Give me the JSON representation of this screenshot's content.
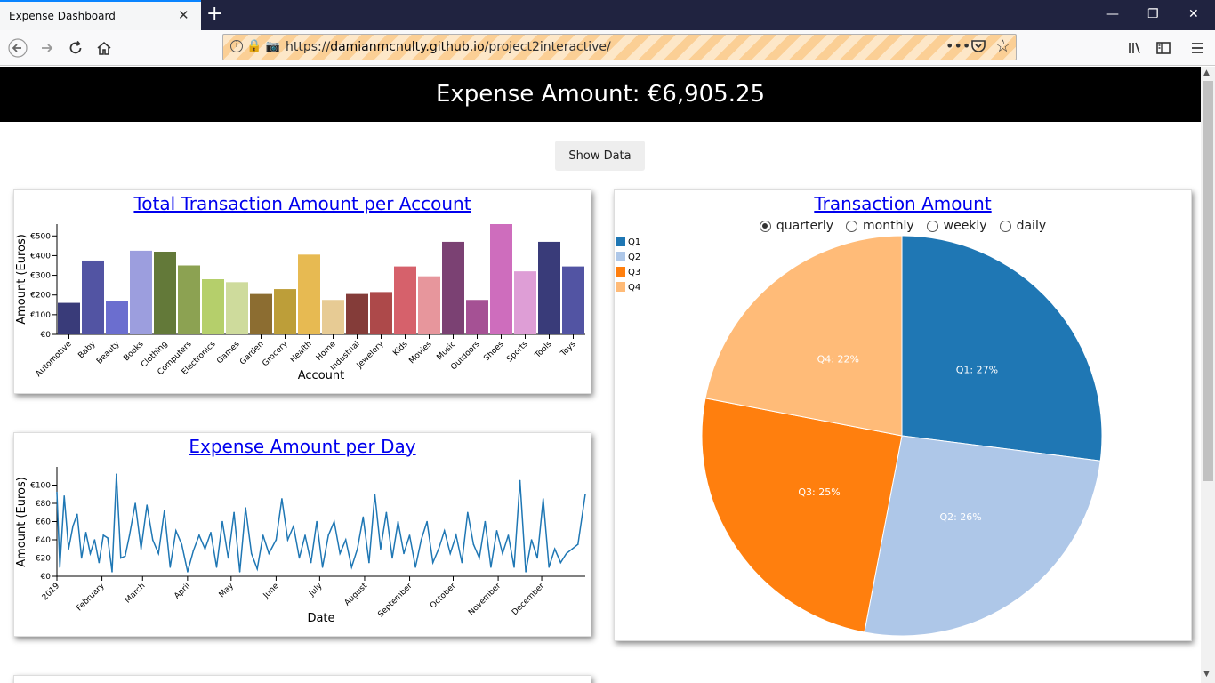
{
  "browser": {
    "tab_title": "Expense Dashboard",
    "url_prefix": "https://",
    "url_host": "damianmcnulty.github.io",
    "url_path": "/project2interactive/"
  },
  "header": {
    "title": "Expense Amount: €6,905.25"
  },
  "show_data_label": "Show Data",
  "colors": {
    "header_bg": "#000000",
    "link": "#0000ee",
    "line": "#1f77b4",
    "q1": "#1f77b4",
    "q2": "#aec7e8",
    "q3": "#ff7f0e",
    "q4": "#ffbb78"
  },
  "bar_card": {
    "title": "Total Transaction Amount per Account"
  },
  "line_card": {
    "title": "Expense Amount per Day"
  },
  "pie_card": {
    "title": "Transaction Amount",
    "radio_options": [
      {
        "label": "quarterly",
        "selected": true
      },
      {
        "label": "monthly",
        "selected": false
      },
      {
        "label": "weekly",
        "selected": false
      },
      {
        "label": "daily",
        "selected": false
      }
    ]
  },
  "chart_data": [
    {
      "type": "bar",
      "title": "Total Transaction Amount per Account",
      "xlabel": "Account",
      "ylabel": "Amount (Euros)",
      "ylim": [
        0,
        560
      ],
      "yticks": [
        "€0",
        "€100",
        "€200",
        "€300",
        "€400",
        "€500"
      ],
      "categories": [
        "Automotive",
        "Baby",
        "Beauty",
        "Books",
        "Clothing",
        "Computers",
        "Electronics",
        "Games",
        "Garden",
        "Grocery",
        "Health",
        "Home",
        "Industrial",
        "Jewelery",
        "Kids",
        "Movies",
        "Music",
        "Outdoors",
        "Shoes",
        "Sports",
        "Tools",
        "Toys"
      ],
      "values": [
        160,
        375,
        170,
        425,
        420,
        350,
        280,
        265,
        205,
        230,
        405,
        175,
        205,
        215,
        345,
        295,
        470,
        175,
        560,
        320,
        470,
        345
      ],
      "bar_colors": [
        "#393b79",
        "#5254a3",
        "#6b6ecf",
        "#9c9ede",
        "#637939",
        "#8ca252",
        "#b5cf6b",
        "#cedb9c",
        "#8c6d31",
        "#bd9e39",
        "#e7ba52",
        "#e7cb94",
        "#843c39",
        "#ad494a",
        "#d6616b",
        "#e7969c",
        "#7b4173",
        "#a55194",
        "#ce6dbd",
        "#de9ed6",
        "#393b79",
        "#5254a3"
      ]
    },
    {
      "type": "line",
      "title": "Expense Amount per Day",
      "xlabel": "Date",
      "ylabel": "Amount (Euros)",
      "ylim": [
        0,
        120
      ],
      "yticks": [
        "€0",
        "€20",
        "€40",
        "€60",
        "€80",
        "€100"
      ],
      "xticks": [
        "2019",
        "February",
        "March",
        "April",
        "May",
        "June",
        "July",
        "August",
        "September",
        "October",
        "November",
        "December"
      ],
      "x": [
        "2019-01-01",
        "2019-01-03",
        "2019-01-06",
        "2019-01-09",
        "2019-01-12",
        "2019-01-15",
        "2019-01-18",
        "2019-01-21",
        "2019-01-24",
        "2019-01-27",
        "2019-01-30",
        "2019-02-02",
        "2019-02-05",
        "2019-02-08",
        "2019-02-11",
        "2019-02-14",
        "2019-02-17",
        "2019-02-20",
        "2019-02-24",
        "2019-02-28",
        "2019-03-04",
        "2019-03-08",
        "2019-03-12",
        "2019-03-16",
        "2019-03-20",
        "2019-03-24",
        "2019-03-28",
        "2019-04-01",
        "2019-04-05",
        "2019-04-09",
        "2019-04-13",
        "2019-04-17",
        "2019-04-21",
        "2019-04-25",
        "2019-04-29",
        "2019-05-03",
        "2019-05-07",
        "2019-05-11",
        "2019-05-15",
        "2019-05-19",
        "2019-05-23",
        "2019-05-27",
        "2019-06-01",
        "2019-06-05",
        "2019-06-09",
        "2019-06-13",
        "2019-06-17",
        "2019-06-21",
        "2019-06-25",
        "2019-06-29",
        "2019-07-03",
        "2019-07-07",
        "2019-07-11",
        "2019-07-15",
        "2019-07-19",
        "2019-07-23",
        "2019-07-27",
        "2019-07-31",
        "2019-08-04",
        "2019-08-08",
        "2019-08-12",
        "2019-08-16",
        "2019-08-20",
        "2019-08-24",
        "2019-08-28",
        "2019-09-01",
        "2019-09-05",
        "2019-09-09",
        "2019-09-13",
        "2019-09-17",
        "2019-09-21",
        "2019-09-25",
        "2019-09-29",
        "2019-10-03",
        "2019-10-07",
        "2019-10-11",
        "2019-10-15",
        "2019-10-19",
        "2019-10-23",
        "2019-10-27",
        "2019-10-31",
        "2019-11-04",
        "2019-11-08",
        "2019-11-12",
        "2019-11-16",
        "2019-11-20",
        "2019-11-24",
        "2019-11-28",
        "2019-12-02",
        "2019-12-06",
        "2019-12-10",
        "2019-12-14",
        "2019-12-18",
        "2019-12-22",
        "2019-12-26",
        "2019-12-31"
      ],
      "values": [
        92,
        10,
        88,
        30,
        55,
        68,
        20,
        48,
        25,
        40,
        15,
        45,
        42,
        5,
        112,
        20,
        22,
        45,
        80,
        30,
        78,
        40,
        25,
        72,
        10,
        50,
        35,
        5,
        28,
        45,
        30,
        48,
        10,
        60,
        20,
        70,
        5,
        75,
        25,
        8,
        45,
        25,
        40,
        85,
        40,
        55,
        20,
        45,
        15,
        60,
        10,
        45,
        60,
        25,
        40,
        10,
        30,
        65,
        15,
        90,
        30,
        70,
        20,
        60,
        25,
        45,
        10,
        40,
        60,
        15,
        30,
        50,
        25,
        45,
        15,
        70,
        35,
        20,
        60,
        10,
        50,
        25,
        45,
        10,
        105,
        5,
        40,
        20,
        85,
        10,
        30,
        15,
        25,
        30,
        35,
        90
      ]
    },
    {
      "type": "pie",
      "title": "Transaction Amount",
      "legend": [
        "Q1",
        "Q2",
        "Q3",
        "Q4"
      ],
      "legend_position": "top-left",
      "slices": [
        {
          "label": "Q1: 27%",
          "name": "Q1",
          "value": 27
        },
        {
          "label": "Q2: 26%",
          "name": "Q2",
          "value": 26
        },
        {
          "label": "Q3: 25%",
          "name": "Q3",
          "value": 25
        },
        {
          "label": "Q4: 22%",
          "name": "Q4",
          "value": 22
        }
      ]
    }
  ]
}
